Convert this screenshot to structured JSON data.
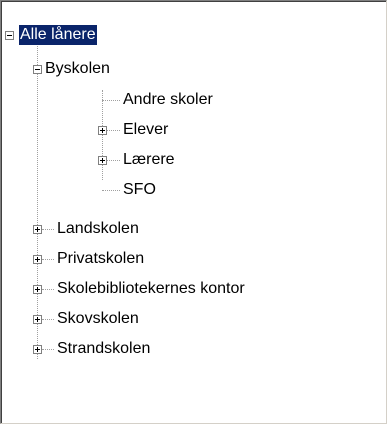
{
  "tree": {
    "root": {
      "label": "Alle lånere",
      "expanded": true,
      "selected": true
    },
    "byskolen": {
      "label": "Byskolen",
      "expanded": true,
      "children": [
        {
          "label": "Andre skoler",
          "has_children": false
        },
        {
          "label": "Elever",
          "has_children": true,
          "expanded": false
        },
        {
          "label": "Lærere",
          "has_children": true,
          "expanded": false
        },
        {
          "label": "SFO",
          "has_children": false
        }
      ]
    },
    "others": [
      {
        "label": "Landskolen",
        "expanded": false
      },
      {
        "label": "Privatskolen",
        "expanded": false
      },
      {
        "label": "Skolebibliotekernes kontor",
        "expanded": false
      },
      {
        "label": "Skovskolen",
        "expanded": false
      },
      {
        "label": "Strandskolen",
        "expanded": false
      }
    ]
  },
  "colors": {
    "selection_bg": "#0a246a",
    "selection_fg": "#ffffff",
    "connector": "#a0a0a0"
  }
}
